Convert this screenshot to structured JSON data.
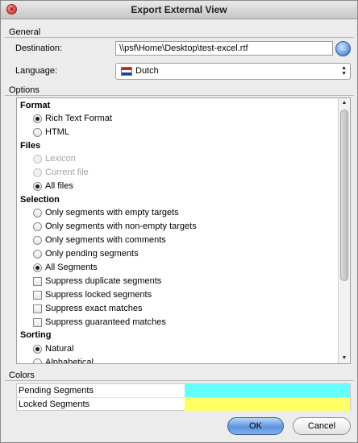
{
  "window": {
    "title": "Export External View",
    "close_icon": "close-icon"
  },
  "general": {
    "section_label": "General",
    "destination_label": "Destination:",
    "destination_value": "\\\\psf\\Home\\Desktop\\test-excel.rtf",
    "browse_label": "...",
    "language_label": "Language:",
    "language_value": "Dutch"
  },
  "options": {
    "section_label": "Options",
    "format": {
      "title": "Format",
      "items": [
        {
          "label": "Rich Text Format",
          "selected": true
        },
        {
          "label": "HTML",
          "selected": false
        }
      ]
    },
    "files": {
      "title": "Files",
      "items": [
        {
          "label": "Lexicon",
          "selected": false,
          "disabled": true
        },
        {
          "label": "Current file",
          "selected": false,
          "disabled": true
        },
        {
          "label": "All files",
          "selected": true
        }
      ]
    },
    "selection": {
      "title": "Selection",
      "radios": [
        {
          "label": "Only segments with empty targets",
          "selected": false
        },
        {
          "label": "Only segments with non-empty targets",
          "selected": false
        },
        {
          "label": "Only segments with comments",
          "selected": false
        },
        {
          "label": "Only pending segments",
          "selected": false
        },
        {
          "label": "All Segments",
          "selected": true
        }
      ],
      "checks": [
        {
          "label": "Suppress duplicate segments",
          "checked": false
        },
        {
          "label": "Suppress locked segments",
          "checked": false
        },
        {
          "label": "Suppress exact matches",
          "checked": false
        },
        {
          "label": "Suppress guaranteed matches",
          "checked": false
        }
      ]
    },
    "sorting": {
      "title": "Sorting",
      "items": [
        {
          "label": "Natural",
          "selected": true
        },
        {
          "label": "Alphabetical",
          "selected": false
        }
      ]
    }
  },
  "colors": {
    "section_label": "Colors",
    "rows": [
      {
        "name": "Pending Segments",
        "color": "#66ffff"
      },
      {
        "name": "Locked Segments",
        "color": "#ffff66"
      }
    ]
  },
  "buttons": {
    "ok": "OK",
    "cancel": "Cancel"
  }
}
